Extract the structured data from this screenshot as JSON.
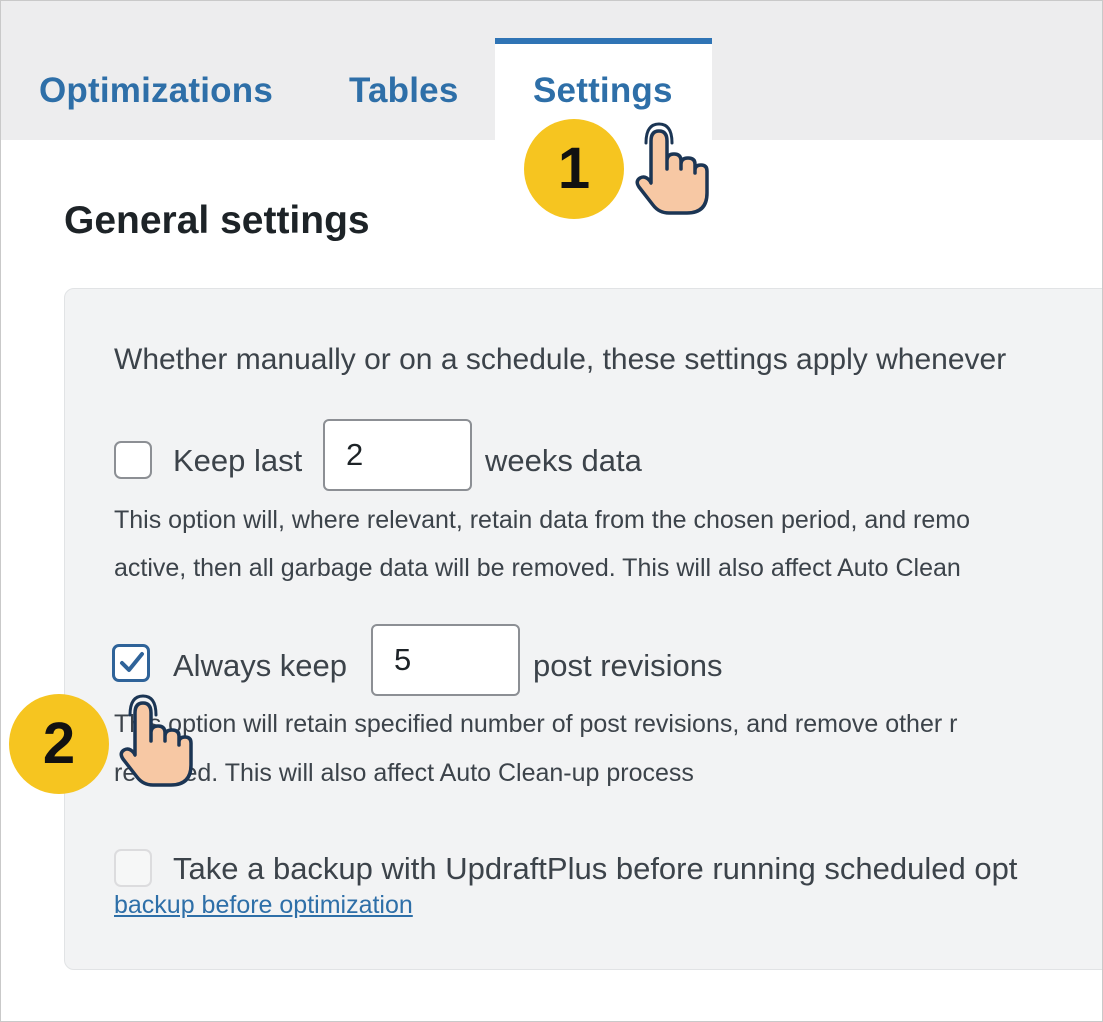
{
  "tabs": [
    {
      "label": "Optimizations",
      "active": false
    },
    {
      "label": "Tables",
      "active": false
    },
    {
      "label": "Settings",
      "active": true
    }
  ],
  "section_title": "General settings",
  "intro_text": "Whether manually or on a schedule, these settings apply whenever",
  "keep_last": {
    "checked": false,
    "prefix": "Keep last",
    "value": "2",
    "suffix": "weeks data",
    "desc_line1": "This option will, where relevant, retain data from the chosen period, and remo",
    "desc_line2": "active, then all garbage data will be removed. This will also affect Auto Clean"
  },
  "always_keep": {
    "checked": true,
    "prefix": "Always keep",
    "value": "5",
    "suffix": "post revisions",
    "desc_line1": "This option will retain specified number of post revisions, and remove other r",
    "desc_line2": "removed. This will also affect Auto Clean-up process"
  },
  "backup": {
    "checked": false,
    "label": "Take a backup with UpdraftPlus before running scheduled opt",
    "link": "backup before optimization"
  },
  "annotations": {
    "step1": "1",
    "step2": "2",
    "badge_color": "#f6c520",
    "hand_fill": "#f7c8a4",
    "hand_stroke": "#1b3554"
  },
  "colors": {
    "accent": "#2e6fa8",
    "tab_underline": "#2f74b5",
    "checkbox_checked": "#2f6399"
  }
}
